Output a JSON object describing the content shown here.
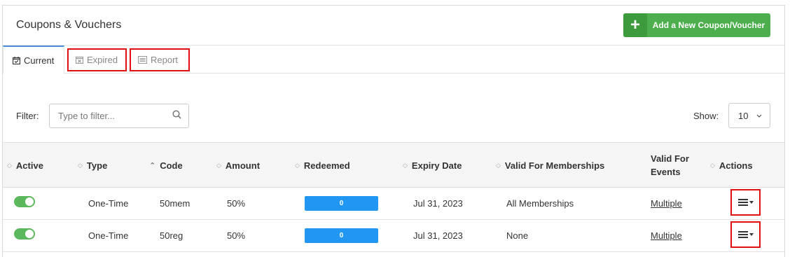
{
  "header": {
    "title": "Coupons & Vouchers",
    "add_button_label": "Add a New Coupon/Voucher"
  },
  "tabs": [
    {
      "label": "Current",
      "icon": "calendar-check-icon",
      "active": true
    },
    {
      "label": "Expired",
      "icon": "calendar-x-icon",
      "active": false
    },
    {
      "label": "Report",
      "icon": "list-report-icon",
      "active": false
    }
  ],
  "filter": {
    "label": "Filter:",
    "placeholder": "Type to filter...",
    "value": ""
  },
  "show": {
    "label": "Show:",
    "value": "10"
  },
  "table": {
    "columns": [
      {
        "label": "Active",
        "sort": "none"
      },
      {
        "label": "Type",
        "sort": "none"
      },
      {
        "label": "Code",
        "sort": "asc"
      },
      {
        "label": "Amount",
        "sort": "none"
      },
      {
        "label": "Redeemed",
        "sort": "none"
      },
      {
        "label": "Expiry Date",
        "sort": "none"
      },
      {
        "label": "Valid For Memberships",
        "sort": "none"
      },
      {
        "label": "Valid For Events",
        "sort": "none"
      },
      {
        "label": "Actions",
        "sort": "none"
      }
    ],
    "rows": [
      {
        "active": true,
        "type": "One-Time",
        "code": "50mem",
        "amount": "50%",
        "redeemed": "0",
        "redeemed_fraction": 1.0,
        "expiry": "Jul 31, 2023",
        "memberships": "All Memberships",
        "events": "Multiple"
      },
      {
        "active": true,
        "type": "One-Time",
        "code": "50reg",
        "amount": "50%",
        "redeemed": "0",
        "redeemed_fraction": 1.0,
        "expiry": "Jul 31, 2023",
        "memberships": "None",
        "events": "Multiple"
      }
    ]
  },
  "colors": {
    "accent_green": "#4cae4c",
    "progress_blue": "#2196f3",
    "highlight_red": "#e01010",
    "active_tab_blue": "#4a90d9"
  }
}
